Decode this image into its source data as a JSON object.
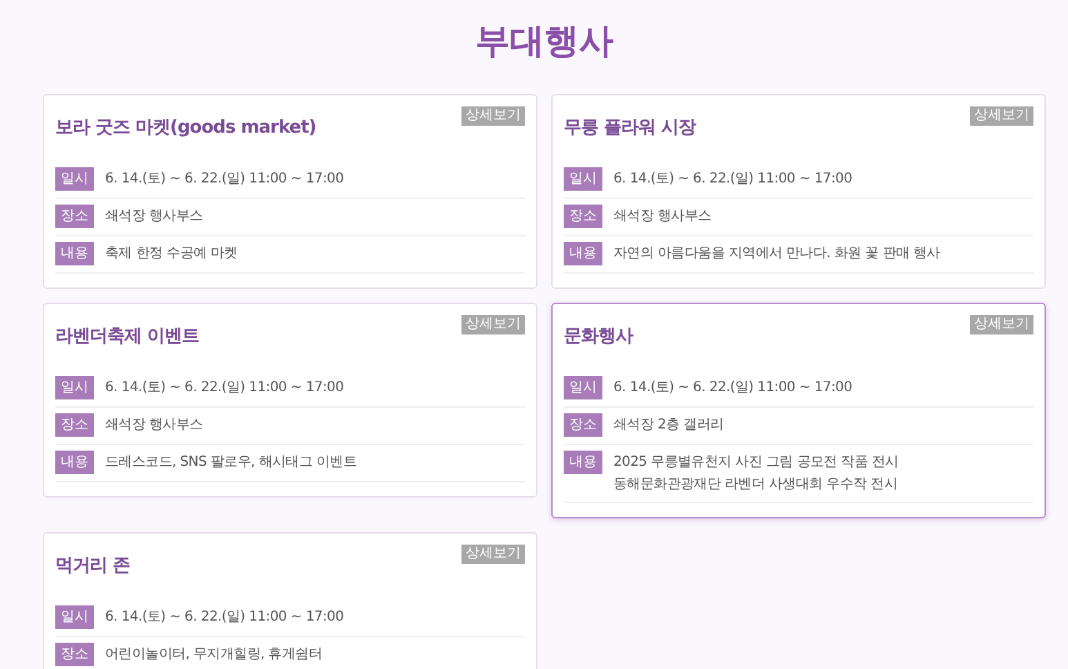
{
  "title": "부대행사",
  "cards": [
    {
      "title": "보라 굿즈 마켓(goods market)",
      "button": "상세보기",
      "hovered": false,
      "rows": [
        {
          "label": "일시",
          "lines": [
            "6. 14.(토) ~ 6. 22.(일) 11:00 ~ 17:00"
          ]
        },
        {
          "label": "장소",
          "lines": [
            "쇄석장 행사부스"
          ]
        },
        {
          "label": "내용",
          "lines": [
            "축제 한정 수공예 마켓"
          ]
        }
      ]
    },
    {
      "title": "무릉 플라워 시장",
      "button": "상세보기",
      "hovered": false,
      "rows": [
        {
          "label": "일시",
          "lines": [
            "6. 14.(토) ~ 6. 22.(일) 11:00 ~ 17:00"
          ]
        },
        {
          "label": "장소",
          "lines": [
            "쇄석장 행사부스"
          ]
        },
        {
          "label": "내용",
          "lines": [
            "자연의 아름다움을 지역에서 만나다. 화원 꽃 판매 행사"
          ]
        }
      ]
    },
    {
      "title": "라벤더축제 이벤트",
      "button": "상세보기",
      "hovered": false,
      "rows": [
        {
          "label": "일시",
          "lines": [
            "6. 14.(토) ~ 6. 22.(일) 11:00 ~ 17:00"
          ]
        },
        {
          "label": "장소",
          "lines": [
            "쇄석장 행사부스"
          ]
        },
        {
          "label": "내용",
          "lines": [
            "드레스코드, SNS 팔로우, 해시태그 이벤트"
          ]
        }
      ]
    },
    {
      "title": "문화행사",
      "button": "상세보기",
      "hovered": true,
      "rows": [
        {
          "label": "일시",
          "lines": [
            "6. 14.(토) ~ 6. 22.(일) 11:00 ~ 17:00"
          ]
        },
        {
          "label": "장소",
          "lines": [
            "쇄석장 2층 갤러리"
          ]
        },
        {
          "label": "내용",
          "lines": [
            "2025 무릉별유천지 사진 그림 공모전 작품 전시",
            "동해문화관광재단 라벤더 사생대회 우수작 전시"
          ]
        }
      ]
    },
    {
      "title": "먹거리 존",
      "button": "상세보기",
      "hovered": false,
      "rows": [
        {
          "label": "일시",
          "lines": [
            "6. 14.(토) ~ 6. 22.(일) 11:00 ~ 17:00"
          ]
        },
        {
          "label": "장소",
          "lines": [
            "어린이놀이터, 무지개힐링, 휴게쉼터"
          ]
        }
      ]
    }
  ]
}
